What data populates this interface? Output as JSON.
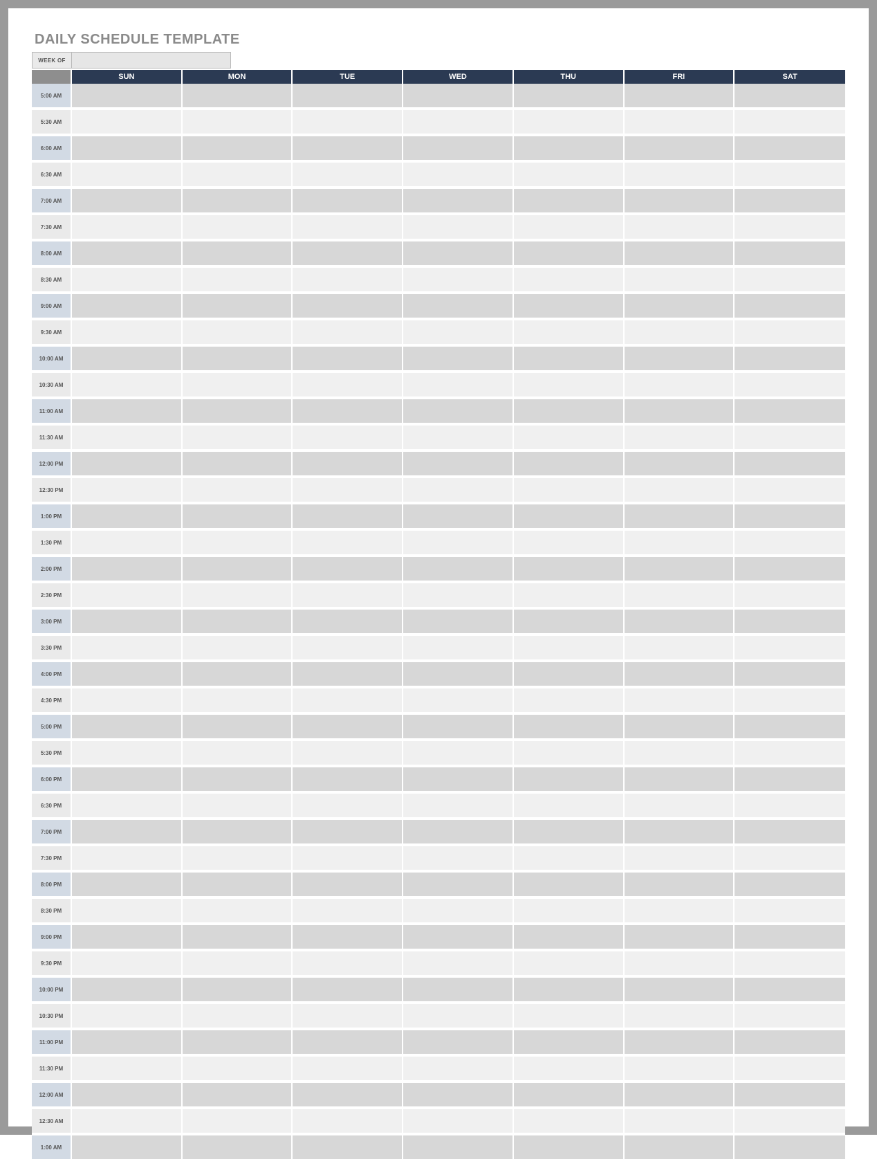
{
  "title": "DAILY SCHEDULE TEMPLATE",
  "weekof_label": "WEEK OF",
  "weekof_value": "",
  "days": [
    "SUN",
    "MON",
    "TUE",
    "WED",
    "THU",
    "FRI",
    "SAT"
  ],
  "times": [
    "5:00 AM",
    "5:30 AM",
    "6:00 AM",
    "6:30 AM",
    "7:00 AM",
    "7:30 AM",
    "8:00 AM",
    "8:30 AM",
    "9:00 AM",
    "9:30 AM",
    "10:00 AM",
    "10:30 AM",
    "11:00 AM",
    "11:30 AM",
    "12:00 PM",
    "12:30 PM",
    "1:00 PM",
    "1:30 PM",
    "2:00 PM",
    "2:30 PM",
    "3:00 PM",
    "3:30 PM",
    "4:00 PM",
    "4:30 PM",
    "5:00 PM",
    "5:30 PM",
    "6:00 PM",
    "6:30 PM",
    "7:00 PM",
    "7:30 PM",
    "8:00 PM",
    "8:30 PM",
    "9:00 PM",
    "9:30 PM",
    "10:00 PM",
    "10:30 PM",
    "11:00 PM",
    "11:30 PM",
    "12:00 AM",
    "12:30 AM",
    "1:00 AM"
  ],
  "colors": {
    "frame_border": "#9a9a9a",
    "title_text": "#8a8a8a",
    "header_time_bg": "#8e8e8e",
    "header_day_bg": "#2b3a53",
    "hour_row_bg": "#d2dae4",
    "hour_row_day_bg": "#d7d7d7",
    "half_row_bg": "#eaeaea",
    "half_row_day_bg": "#f0f0f0"
  }
}
